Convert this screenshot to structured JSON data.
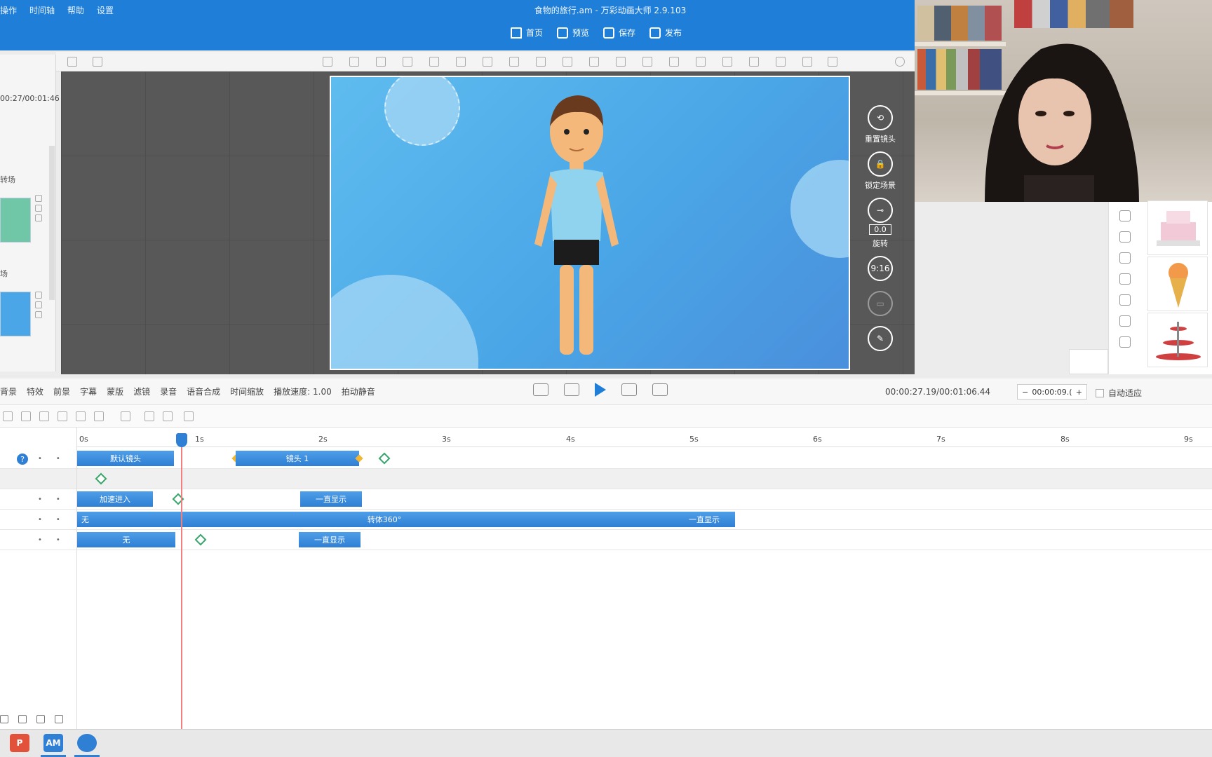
{
  "menu": [
    "操作",
    "时间轴",
    "帮助",
    "设置"
  ],
  "window_title": "食物的旅行.am - 万彩动画大师 2.9.103",
  "main_tools": [
    {
      "label": "首页",
      "icon": "home-icon"
    },
    {
      "label": "预览",
      "icon": "preview-icon"
    },
    {
      "label": "保存",
      "icon": "save-icon"
    },
    {
      "label": "发布",
      "icon": "publish-icon"
    }
  ],
  "left_panel": {
    "time": "00:27/00:01:46",
    "scene_labels": [
      "转场",
      "场"
    ]
  },
  "canvas_side_tools": [
    {
      "label": "重置镜头",
      "icon": "reset-camera-icon"
    },
    {
      "label": "锁定场景",
      "icon": "lock-icon"
    },
    {
      "label": "旋转",
      "icon": "rotate-icon",
      "value": "0.0"
    },
    {
      "label": "",
      "icon": "ratio-icon",
      "value": "9:16"
    },
    {
      "label": "",
      "icon": "ratio-16-9-icon"
    },
    {
      "label": "",
      "icon": "edit-icon"
    }
  ],
  "control_bar": {
    "tools": [
      "背景",
      "特效",
      "前景",
      "字幕",
      "蒙版",
      "滤镜",
      "录音",
      "语音合成",
      "时间缩放",
      "播放速度: 1.00",
      "拍动静音"
    ],
    "time": "00:00:27.19/00:01:06.44",
    "step_value": "00:00:09.(",
    "auto_fit": "自动适应"
  },
  "ruler": [
    "0s",
    "1s",
    "2s",
    "3s",
    "4s",
    "5s",
    "6s",
    "7s",
    "8s",
    "9s"
  ],
  "tracks": [
    {
      "clips": [
        {
          "label": "默认镜头"
        },
        {
          "label": "镜头 1"
        }
      ]
    },
    {
      "clips": []
    },
    {
      "clips": [
        {
          "label": "加速进入"
        },
        {
          "label": "一直显示"
        }
      ]
    },
    {
      "clips": [
        {
          "label": "无"
        },
        {
          "label": "转体360°"
        },
        {
          "label": "一直显示"
        }
      ]
    },
    {
      "clips": [
        {
          "label": "无"
        },
        {
          "label": "一直显示"
        }
      ]
    }
  ],
  "taskbar": [
    {
      "label": "P",
      "color": "#e2523a"
    },
    {
      "label": "AM",
      "color": "#2f7fd5"
    },
    {
      "label": "",
      "color": "#2f7fd5"
    }
  ]
}
